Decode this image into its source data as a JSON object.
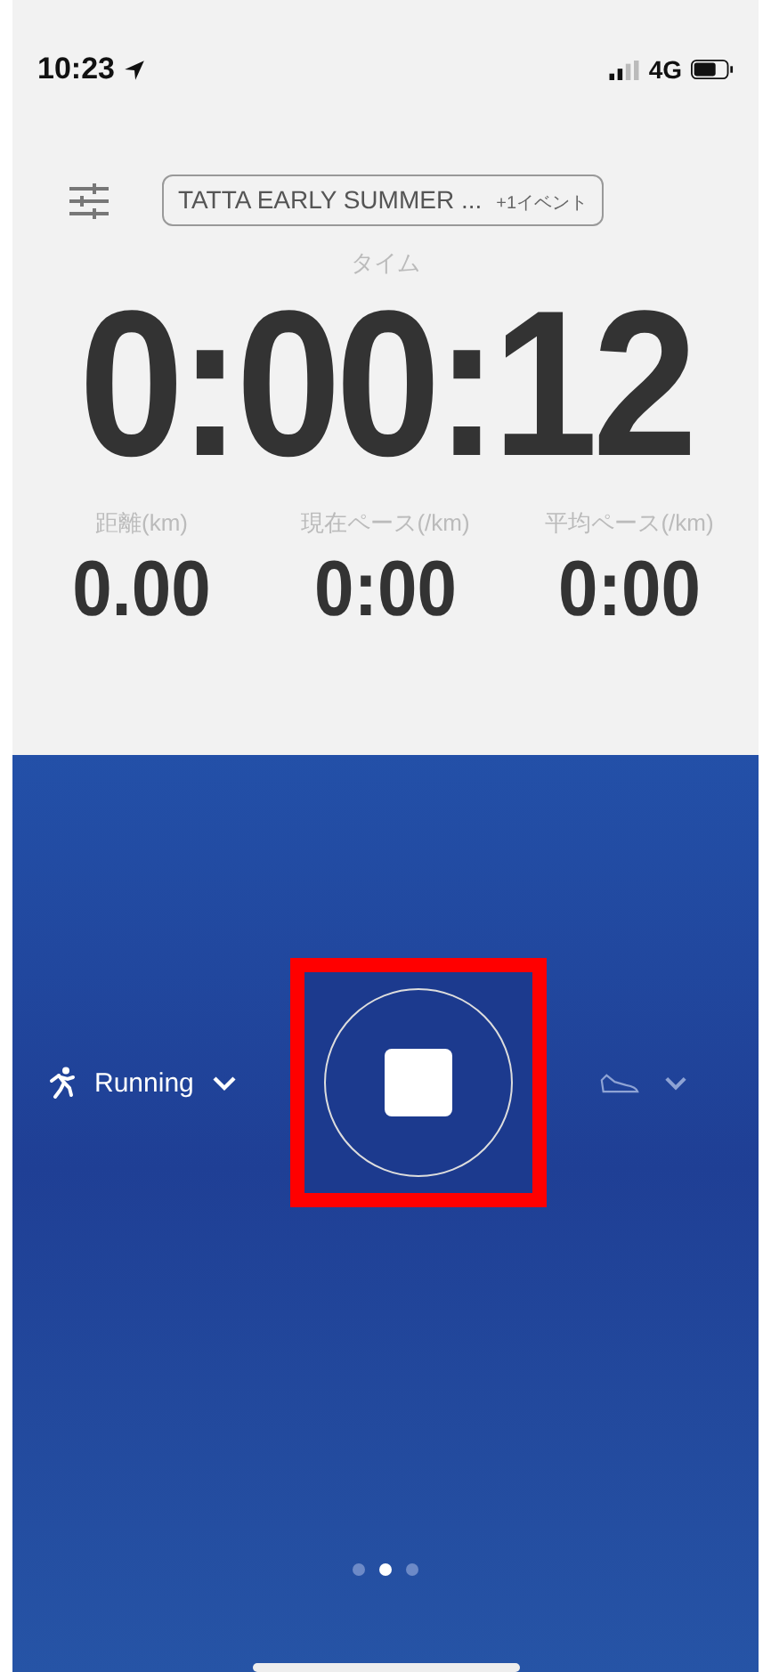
{
  "status_bar": {
    "time": "10:23",
    "network": "4G"
  },
  "event_chip": {
    "title": "TATTA EARLY SUMMER ...",
    "extra": "+1イベント"
  },
  "time": {
    "label": "タイム",
    "value": "0:00:12"
  },
  "stats": [
    {
      "label": "距離(km)",
      "value": "0.00"
    },
    {
      "label": "現在ペース(/km)",
      "value": "0:00"
    },
    {
      "label": "平均ペース(/km)",
      "value": "0:00"
    }
  ],
  "activity": {
    "label": "Running"
  },
  "pages": [
    {
      "selected": false
    },
    {
      "selected": true
    },
    {
      "selected": false
    }
  ]
}
